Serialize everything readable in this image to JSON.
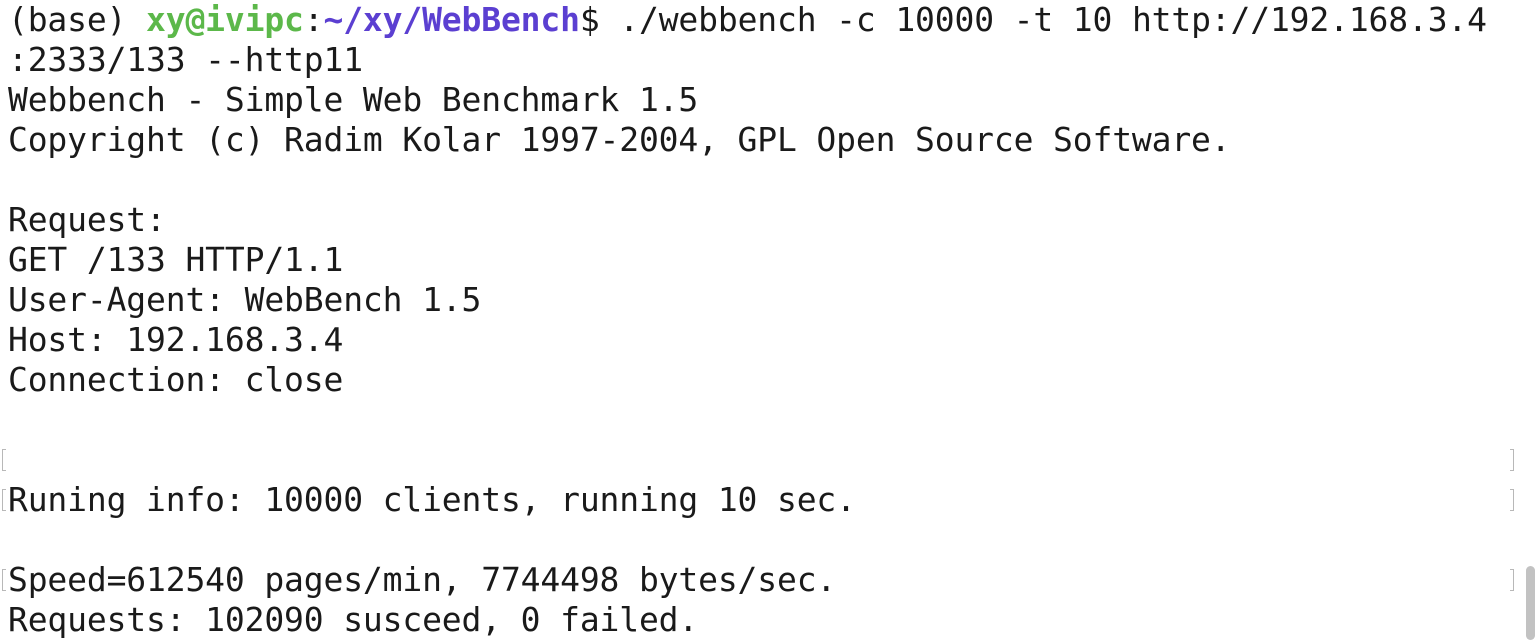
{
  "prompt": {
    "env": "(base) ",
    "user_host": "xy@ivipc",
    "colon": ":",
    "cwd": "~/xy/WebBench",
    "symbol": "$",
    "command": " ./webbench -c 10000 -t 10 http://192.168.3.4",
    "command_wrap": ":2333/133 --http11"
  },
  "output": {
    "banner": "Webbench - Simple Web Benchmark 1.5",
    "copyright": "Copyright (c) Radim Kolar 1997-2004, GPL Open Source Software.",
    "request_header": "Request:",
    "request_line": "GET /133 HTTP/1.1",
    "user_agent": "User-Agent: WebBench 1.5",
    "host": "Host: 192.168.3.4",
    "connection": "Connection: close",
    "running_info": "Runing info: 10000 clients, running 10 sec.",
    "speed": "Speed=612540 pages/min, 7744498 bytes/sec.",
    "requests": "Requests: 102090 susceed, 0 failed."
  },
  "scroll_position_fraction": 0.88
}
